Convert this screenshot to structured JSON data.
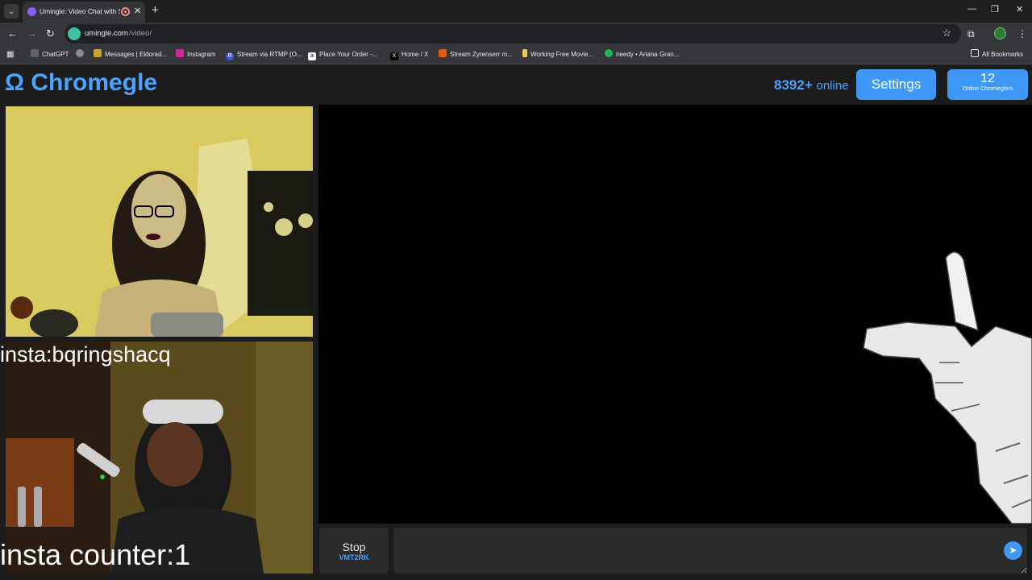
{
  "browser": {
    "tab": {
      "title": "Umingle: Video Chat with S"
    },
    "new_tab_glyph": "+",
    "url_host": "umingle.com",
    "url_path": "/video/",
    "bookmarks": [
      {
        "label": "ChatGPT",
        "color": "#5f6368"
      },
      {
        "label": "",
        "color": "#8a8a8a"
      },
      {
        "label": "Messages | Eldorad...",
        "color": "#c9a227"
      },
      {
        "label": "Instagram",
        "color": "#d6249f"
      },
      {
        "label": "Stream via RTMP (O...",
        "color": "#3b5bdb"
      },
      {
        "label": "Place Your Order -...",
        "color": "#ffffff"
      },
      {
        "label": "Home / X",
        "color": "#000000"
      },
      {
        "label": "Stream Zyrenserr m...",
        "color": "#e8590c"
      },
      {
        "label": "Working Free Movie...",
        "color": "#f2c94c"
      },
      {
        "label": "needy • Ariana Gran...",
        "color": "#1db954"
      }
    ],
    "all_bookmarks": "All Bookmarks"
  },
  "app": {
    "logo": "Ω Chromegle",
    "online_count": "8392+",
    "online_word": "online",
    "settings_label": "Settings",
    "online_chromeglers_count": "12",
    "online_chromeglers_label": "Online Chromeglers",
    "overlay_handle": "insta:bqringshacq",
    "overlay_counter": "insta counter:1",
    "stop_label": "Stop",
    "stop_code": "VMT2RK",
    "chat_placeholder": ""
  },
  "colors": {
    "accent": "#3d99f5",
    "logo": "#4aa3ff",
    "background": "#1c1c1c"
  }
}
